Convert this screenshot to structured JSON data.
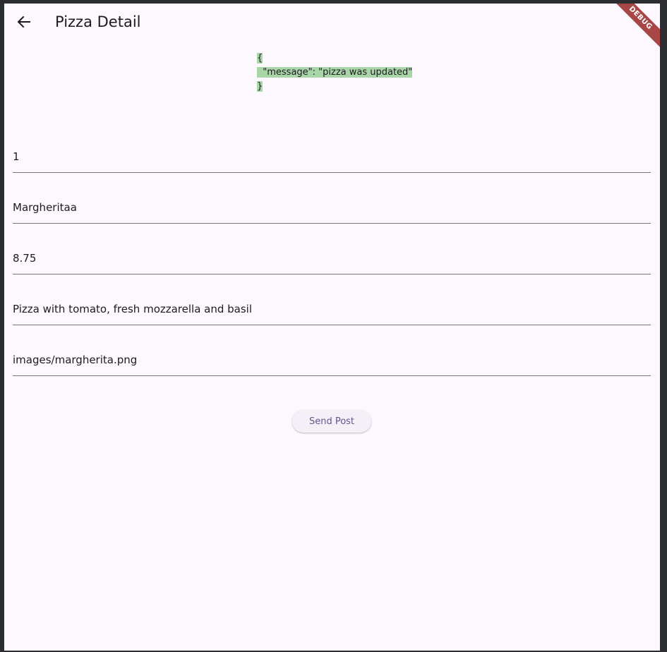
{
  "appbar": {
    "title": "Pizza Detail",
    "back_icon": "arrow-left-icon"
  },
  "debug_banner": "DEBUG",
  "response": {
    "open": "{",
    "body": "  \"message\": \"pizza was updated\"",
    "close": "}",
    "highlight_color": "#a8d6a8"
  },
  "fields": [
    {
      "name": "id",
      "value": "1"
    },
    {
      "name": "pizza-name",
      "value": "Margheritaa"
    },
    {
      "name": "price",
      "value": "8.75"
    },
    {
      "name": "description",
      "value": "Pizza with tomato, fresh mozzarella and basil"
    },
    {
      "name": "image-url",
      "value": "images/margherita.png"
    }
  ],
  "send_button": {
    "label": "Send Post"
  },
  "colors": {
    "background": "#fdf7fe",
    "text": "#1d1b20",
    "underline": "#79747e",
    "button_text": "#65558f",
    "debug": "#a84545"
  }
}
